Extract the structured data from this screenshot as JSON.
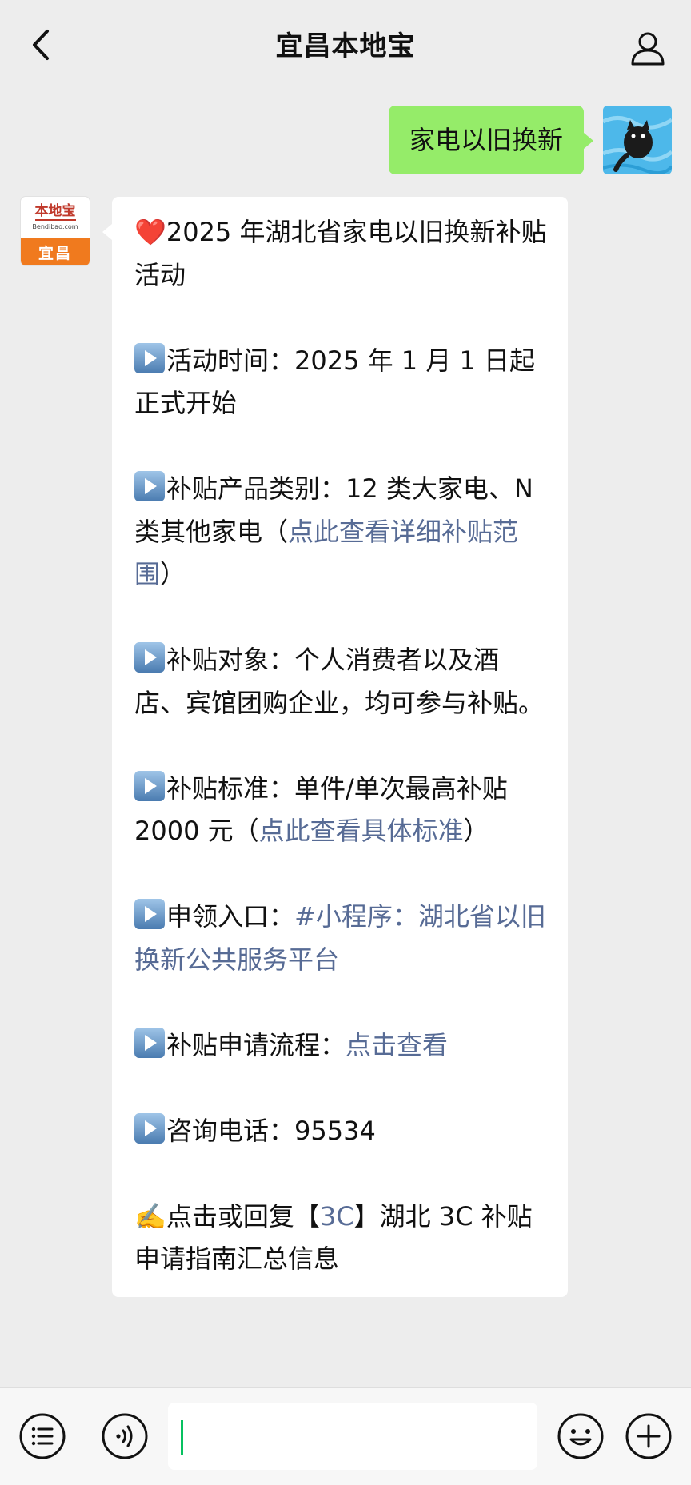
{
  "header": {
    "title": "宜昌本地宝"
  },
  "outgoing": {
    "text": "家电以旧换新"
  },
  "bot_avatar": {
    "brand": "本地宝",
    "domain": "Bendibao.com",
    "city": "宜昌"
  },
  "incoming": {
    "heart": "❤️",
    "title": "2025 年湖北省家电以旧换新补贴活动",
    "time": "活动时间：2025 年 1 月 1 日起正式开始",
    "category_prefix": "补贴产品类别：12 类大家电、N 类其他家电（",
    "category_link": "点此查看详细补贴范围",
    "category_suffix": "）",
    "target": "补贴对象：个人消费者以及酒店、宾馆团购企业，均可参与补贴。",
    "standard_prefix": "补贴标准：单件/单次最高补贴 2000 元（",
    "standard_link": "点此查看具体标准",
    "standard_suffix": "）",
    "entry_prefix": "申领入口：",
    "entry_link": "#小程序：湖北省以旧换新公共服务平台",
    "process_prefix": "补贴申请流程：",
    "process_link": "点击查看",
    "phone": "咨询电话：95534",
    "write_emoji": "✍️",
    "footer_prefix": "点击或回复【",
    "footer_link": "3C",
    "footer_suffix": "】湖北 3C 补贴申请指南汇总信息"
  },
  "input": {
    "value": ""
  },
  "icons": [
    "back-icon",
    "profile-icon",
    "menu-list-icon",
    "voice-icon",
    "emoji-icon",
    "plus-icon"
  ]
}
